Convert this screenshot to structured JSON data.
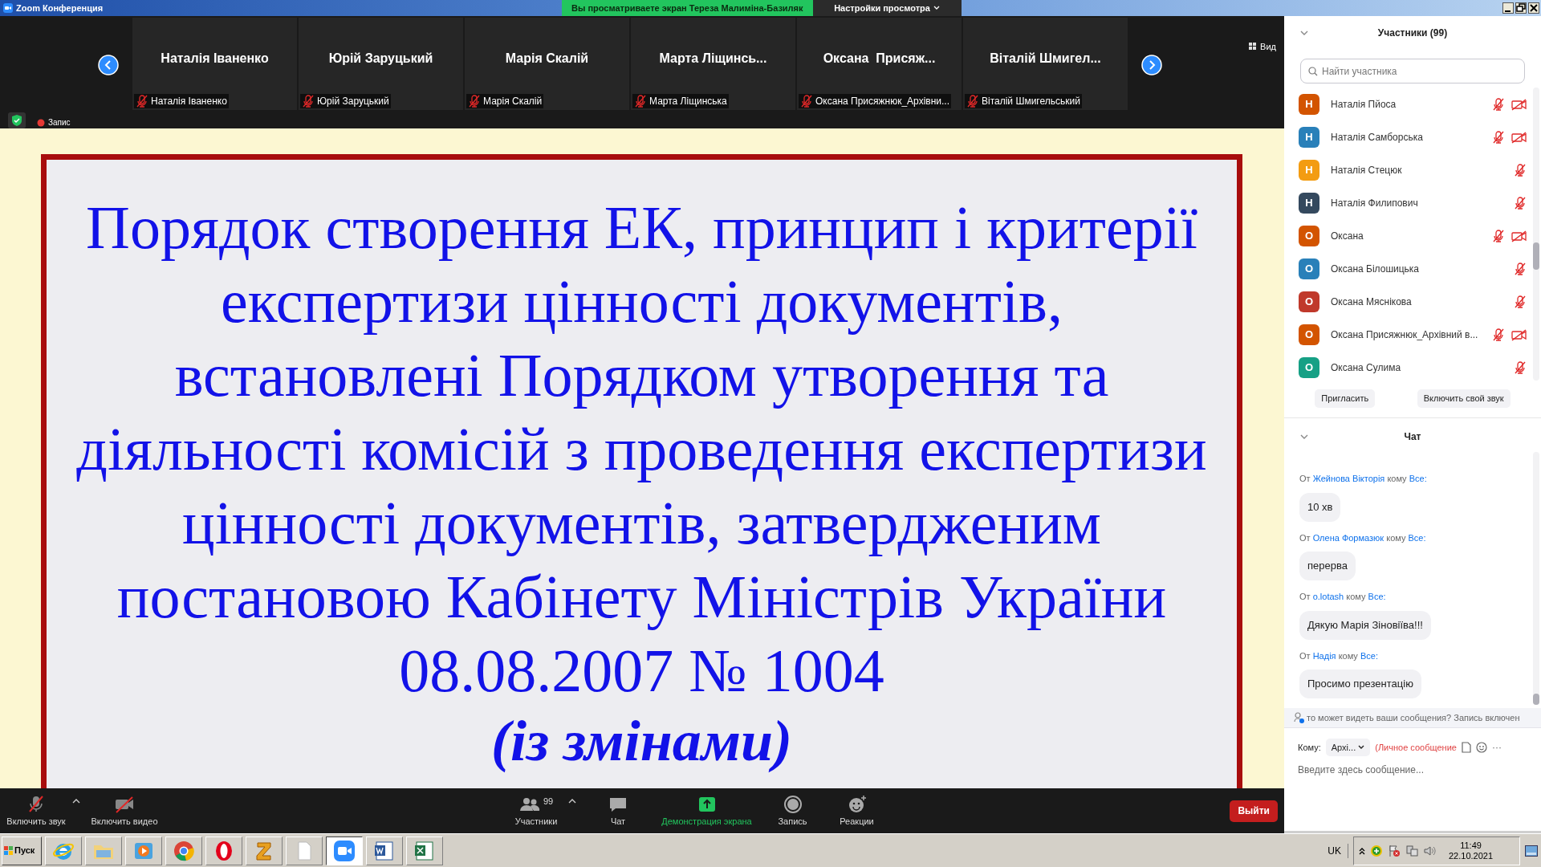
{
  "window": {
    "title": "Zoom Конференция"
  },
  "share_banner": {
    "text": "Вы просматриваете экран Тереза Малиміна-Базиляк",
    "view_options": "Настройки просмотра"
  },
  "view_button": "Вид",
  "video_strip": [
    {
      "name": "Наталія Іваненко",
      "label": "Наталія Іваненко",
      "muted": true
    },
    {
      "name": "Юрій Заруцький",
      "label": "Юрій Заруцький",
      "muted": true
    },
    {
      "name": "Марія Скалій",
      "label": "Марія Скалій",
      "muted": true
    },
    {
      "name": "Марта Ліщинсь...",
      "label": "Марта Ліщинська",
      "muted": true
    },
    {
      "name": "Оксана  Присяж...",
      "label": "Оксана Присяжнюк_Архівни...",
      "muted": true
    },
    {
      "name": "Віталій Шмигел...",
      "label": "Віталій Шмигельський",
      "muted": true
    }
  ],
  "recording": {
    "label": "Запис"
  },
  "slide": {
    "title_lines": [
      "Порядок створення ЕК, принцип і критерії",
      "експертизи цінності документів,",
      "встановлені  Порядком утворення та",
      "діяльності комісій з проведення експертизи",
      "цінності документів, затвердженим",
      "постановою Кабінету Міністрів України",
      "08.08.2007 № 1004"
    ],
    "subtitle": "(із змінами)"
  },
  "participants": {
    "title": "Участники (99)",
    "search": {
      "placeholder": "Найти участника"
    },
    "items": [
      {
        "initial": "Н",
        "name": "Наталія Пйоса",
        "color": "#d35400",
        "muted": true,
        "video_off": true
      },
      {
        "initial": "Н",
        "name": "Наталія Самборська",
        "color": "#2980b9",
        "muted": true,
        "video_off": true
      },
      {
        "initial": "Н",
        "name": "Наталія Стецюк",
        "color": "#f39c12",
        "muted": true,
        "video_off": false
      },
      {
        "initial": "Н",
        "name": "Наталія Филипович",
        "color": "#34495e",
        "muted": true,
        "video_off": false
      },
      {
        "initial": "О",
        "name": "Оксана",
        "color": "#d35400",
        "muted": true,
        "video_off": true
      },
      {
        "initial": "О",
        "name": "Оксана Білошицька",
        "color": "#2980b9",
        "muted": true,
        "video_off": false
      },
      {
        "initial": "О",
        "name": "Оксана Мяснікова",
        "color": "#c0392b",
        "muted": true,
        "video_off": false
      },
      {
        "initial": "О",
        "name": "Оксана Присяжнюк_Архівний в...",
        "color": "#d35400",
        "muted": true,
        "video_off": true
      },
      {
        "initial": "О",
        "name": "Оксана Сулима",
        "color": "#16a085",
        "muted": true,
        "video_off": false
      }
    ],
    "buttons": [
      "Пригласить",
      "Включить свой звук"
    ]
  },
  "chat": {
    "title": "Чат",
    "messages": [
      {
        "from_label": "От",
        "sender": "Жейнова Вікторія",
        "to_label": "кому",
        "recipient": "Все:",
        "text": "10 хв"
      },
      {
        "from_label": "От",
        "sender": "Олена Формазюк",
        "to_label": "кому",
        "recipient": "Все:",
        "text": "перерва"
      },
      {
        "from_label": "От",
        "sender": "o.lotash",
        "to_label": "кому",
        "recipient": "Все:",
        "text": "Дякую Марія Зіновіїва!!!"
      },
      {
        "from_label": "От",
        "sender": "Надія",
        "to_label": "кому",
        "recipient": "Все:",
        "text": "Просимо презентацію"
      }
    ],
    "notice": "то может видеть ваши сообщения? Запись включен",
    "to_label": "Кому:",
    "to_value": "Архі...",
    "private_label": "(Личное сообщение",
    "more": "···",
    "input": {
      "placeholder": "Введите здесь сообщение..."
    }
  },
  "toolbar": [
    {
      "kind": "mic",
      "label": "Включить звук",
      "caret": true
    },
    {
      "kind": "video",
      "label": "Включить видео",
      "caret": false
    },
    {
      "kind": "participants",
      "label": "Участники",
      "count": "99",
      "caret": true
    },
    {
      "kind": "chat",
      "label": "Чат",
      "caret": false
    },
    {
      "kind": "share",
      "label": "Демонстрация экрана",
      "caret": false
    },
    {
      "kind": "record",
      "label": "Запись",
      "caret": false
    },
    {
      "kind": "reactions",
      "label": "Реакции",
      "caret": false
    }
  ],
  "leave_button": "Выйти",
  "taskbar": {
    "start": "Пуск",
    "apps": [
      {
        "kind": "ie",
        "selected": false
      },
      {
        "kind": "folder",
        "selected": false
      },
      {
        "kind": "media",
        "selected": false
      },
      {
        "kind": "chrome",
        "selected": false
      },
      {
        "kind": "opera",
        "selected": false
      },
      {
        "kind": "z",
        "selected": false
      },
      {
        "kind": "file",
        "selected": false
      },
      {
        "kind": "zoom",
        "selected": true
      },
      {
        "kind": "word",
        "selected": false
      },
      {
        "kind": "excel",
        "selected": false
      }
    ],
    "language": "UK",
    "time": "11:49",
    "date": "22.10.2021"
  }
}
